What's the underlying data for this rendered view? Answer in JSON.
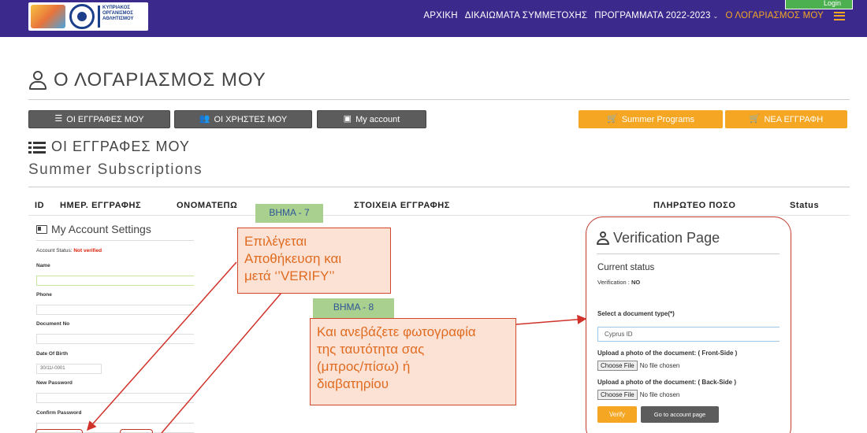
{
  "header": {
    "logo_text": [
      "ΚΥΠΡΙΑΚΟΣ",
      "ΟΡΓΑΝΙΣΜΟΣ",
      "ΑΘΛΗΤΙΣΜΟΥ"
    ],
    "nav": {
      "home": "ΑΡΧΙΚΗ",
      "rights": "ΔΙΚΑΙΩΜΑΤΑ ΣΥΜΜΕΤΟΧΗΣ",
      "programs": "ΠΡΟΓΡΑΜΜΑΤΑ 2022-2023",
      "account": "Ο ΛΟΓΑΡΙΑΣΜΟΣ ΜΟΥ"
    },
    "login_label": "Login"
  },
  "page": {
    "title": "Ο ΛΟΓΑΡΙΑΣΜΟΣ ΜΟΥ",
    "section_title": "ΟΙ ΕΓΓΡΑΦΕΣ ΜΟΥ",
    "subtitle": "Summer Subscriptions"
  },
  "buttons": {
    "registrations": "ΟΙ ΕΓΓΡΑΦΕΣ ΜΟΥ",
    "users": "ΟΙ ΧΡΗΣΤΕΣ ΜΟΥ",
    "my_account": "My account",
    "summer_programs": "Summer Programs",
    "new_registration": "ΝΕΑ ΕΓΓΡΑΦΗ"
  },
  "table": {
    "headers": {
      "id": "ID",
      "date": "ΗΜΕΡ. ΕΓΓΡΑΦΗΣ",
      "name": "ΟΝΟΜΑΤΕΠΩ",
      "details": "ΣΤΟΙΧΕΙΑ ΕΓΓΡΑΦΗΣ",
      "amount": "ΠΛΗΡΩΤΕΟ ΠΟΣΟ",
      "status": "Status"
    }
  },
  "account_settings": {
    "title": "My Account Settings",
    "status_label": "Account Status:",
    "status_value": "Not verified",
    "name_label": "Name",
    "phone_label": "Phone",
    "document_label": "Document No",
    "dob_label": "Date Of Birth",
    "dob_value": "30/11/-0001",
    "new_password_label": "New Password",
    "confirm_password_label": "Confirm Password"
  },
  "annotations": {
    "step7": "ΒΗΜΑ - 7",
    "step7_text": [
      "Επιλέγεται",
      "Αποθήκευση και",
      "μετά ‘’VERIFY’’"
    ],
    "step8": "ΒΗΜΑ - 8",
    "step8_text": [
      "Και ανεβάζετε φωτογραφία",
      "της ταυτότητα σας",
      "(μπρος/πίσω) ή",
      "διαβατηρίου"
    ]
  },
  "verification": {
    "title": "Verification Page",
    "current_status": "Current status",
    "verification_label": "Verification :",
    "verification_value": "NO",
    "doc_type_label": "Select a document type(*)",
    "doc_type_value": "Cyprus ID",
    "front_label": "Upload a photo of the document: ( Front-Side )",
    "back_label": "Upload a photo of the document: ( Back-Side )",
    "choose_file": "Choose File",
    "no_file": "No file chosen",
    "verify_button": "Verify",
    "goto_button": "Go to account page"
  },
  "colors": {
    "header_bg": "#3b2a8c",
    "accent_orange": "#f5a623",
    "dark_button": "#5c5c5c",
    "callout_fill": "#fbe2d5",
    "callout_border": "#d0492d",
    "step_fill": "#a9d08e",
    "arrow_red": "#d0322a"
  },
  "icons": {
    "title": "user-icon",
    "list": "list-icon",
    "users": "users-icon",
    "card": "id-card-icon",
    "cart": "cart-icon",
    "menu": "hamburger-icon"
  }
}
